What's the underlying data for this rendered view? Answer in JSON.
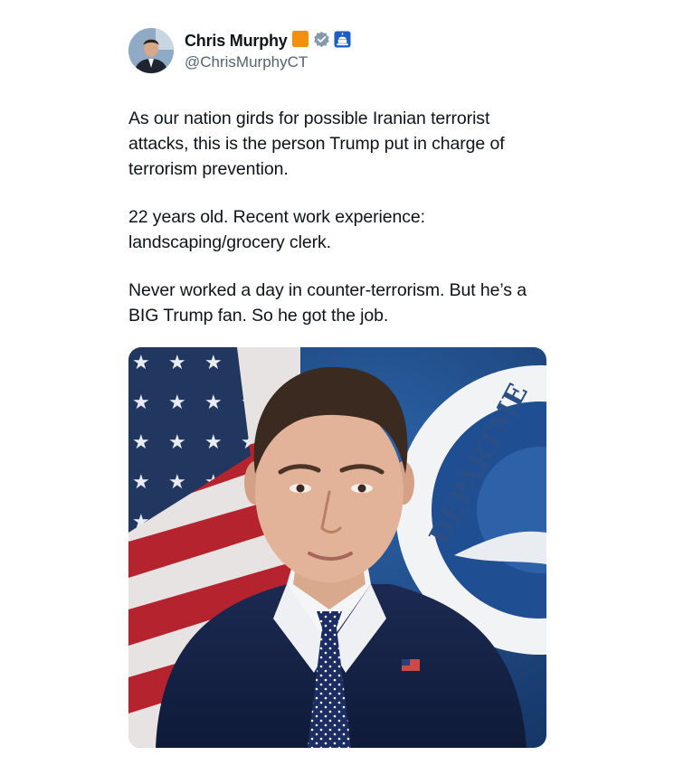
{
  "author": {
    "display_name": "Chris Murphy",
    "handle": "@ChrisMurphyCT"
  },
  "badges": [
    "orange-square-emoji",
    "verified-icon",
    "capitol-building-icon"
  ],
  "tweet": {
    "paragraphs": [
      "As our nation girds for possible Iranian terrorist attacks, this is the person Trump put in charge of terrorism prevention.",
      "22 years old. Recent work experience: landscaping/grocery clerk.",
      "Never worked a day in counter-terrorism. But he’s a BIG Trump fan. So he got the job."
    ]
  },
  "media": {
    "seal_text": "DEPARTME"
  },
  "colors": {
    "text": "#0f1419",
    "secondary": "#536471",
    "verified": "#829aab",
    "orange_square": "#f4900c",
    "capitol_badge": "#1d5ec5"
  }
}
